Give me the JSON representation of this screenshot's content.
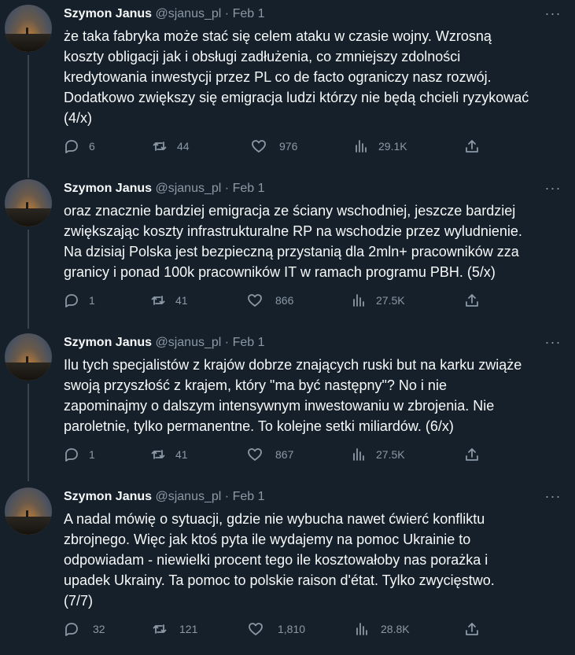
{
  "tweets": [
    {
      "author_name": "Szymon Janus",
      "handle": "@sjanus_pl",
      "separator": "·",
      "date": "Feb 1",
      "text": "że taka fabryka może stać się celem ataku w czasie wojny. Wzrosną\nkoszty obligacji jak i obsługi zadłużenia, co zmniejszy zdolności\nkredytowania inwestycji przez PL co de facto ograniczy nasz rozwój.\nDodatkowo zwiększy się emigracja ludzi którzy nie będą chcieli ryzykować\n(4/x)",
      "replies": "6",
      "retweets": "44",
      "likes": "976",
      "views": "29.1K"
    },
    {
      "author_name": "Szymon Janus",
      "handle": "@sjanus_pl",
      "separator": "·",
      "date": "Feb 1",
      "text": "oraz znacznie bardziej emigracja ze ściany wschodniej, jeszcze bardziej\nzwiększając koszty infrastrukturalne RP na wschodzie przez wyludnienie.\nNa dzisiaj Polska jest bezpieczną przystanią dla 2mln+ pracowników zza\ngranicy i ponad 100k pracowników IT w ramach programu PBH. (5/x)",
      "replies": "1",
      "retweets": "41",
      "likes": "866",
      "views": "27.5K"
    },
    {
      "author_name": "Szymon Janus",
      "handle": "@sjanus_pl",
      "separator": "·",
      "date": "Feb 1",
      "text": "Ilu tych specjalistów z krajów dobrze znających ruski but na karku zwiąże\nswoją przyszłość z krajem, który \"ma być następny\"? No i nie\nzapominajmy o dalszym intensywnym inwestowaniu w zbrojenia. Nie\nparoletnie, tylko permanentne. To kolejne setki miliardów. (6/x)",
      "replies": "1",
      "retweets": "41",
      "likes": "867",
      "views": "27.5K"
    },
    {
      "author_name": "Szymon Janus",
      "handle": "@sjanus_pl",
      "separator": "·",
      "date": "Feb 1",
      "text": "A nadal mówię o sytuacji, gdzie nie wybucha nawet ćwierć konfliktu\nzbrojnego. Więc jak ktoś pyta ile wydajemy na pomoc Ukrainie to\nodpowiadam - niewielki procent tego ile kosztowałoby nas porażka i\nupadek Ukrainy. Ta pomoc to polskie raison d'état. Tylko zwycięstwo.\n(7/7)",
      "replies": "32",
      "retweets": "121",
      "likes": "1,810",
      "views": "28.8K"
    }
  ],
  "icons": {
    "reply": "reply-icon",
    "retweet": "retweet-icon",
    "like": "heart-icon",
    "views": "views-chart-icon",
    "share": "share-icon",
    "more": "more-options-icon"
  },
  "colors": {
    "background": "#15202b",
    "text": "#f7f9f9",
    "secondary": "#8b98a5",
    "thread_line": "#38444d"
  }
}
